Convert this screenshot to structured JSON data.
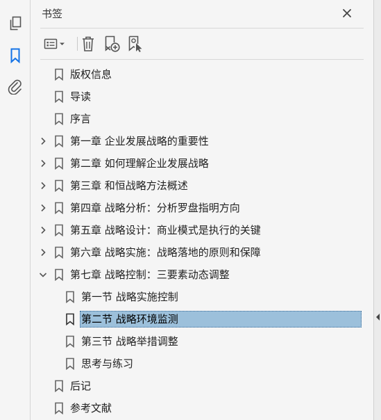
{
  "panel": {
    "title": "书签"
  },
  "tree": [
    {
      "label": "版权信息",
      "level": 1,
      "expandable": false
    },
    {
      "label": "导读",
      "level": 1,
      "expandable": false
    },
    {
      "label": "序言",
      "level": 1,
      "expandable": false
    },
    {
      "label": "第一章 企业发展战略的重要性",
      "level": 1,
      "expandable": true,
      "expanded": false
    },
    {
      "label": "第二章 如何理解企业发展战略",
      "level": 1,
      "expandable": true,
      "expanded": false
    },
    {
      "label": "第三章 和恒战略方法概述",
      "level": 1,
      "expandable": true,
      "expanded": false
    },
    {
      "label": "第四章 战略分析：分析罗盘指明方向",
      "level": 1,
      "expandable": true,
      "expanded": false
    },
    {
      "label": "第五章 战略设计：商业模式是执行的关键",
      "level": 1,
      "expandable": true,
      "expanded": false
    },
    {
      "label": "第六章 战略实施：战略落地的原则和保障",
      "level": 1,
      "expandable": true,
      "expanded": false
    },
    {
      "label": "第七章 战略控制：三要素动态调整",
      "level": 1,
      "expandable": true,
      "expanded": true
    },
    {
      "label": "第一节 战略实施控制",
      "level": 2,
      "expandable": false
    },
    {
      "label": "第二节 战略环境监测",
      "level": 2,
      "expandable": false,
      "selected": true
    },
    {
      "label": "第三节 战略举措调整",
      "level": 2,
      "expandable": false
    },
    {
      "label": "思考与练习",
      "level": 2,
      "expandable": false
    },
    {
      "label": "后记",
      "level": 1,
      "expandable": false
    },
    {
      "label": "参考文献",
      "level": 1,
      "expandable": false
    }
  ],
  "icons": {
    "rail": [
      "pages-icon",
      "bookmarks-icon",
      "attachments-icon"
    ],
    "toolbar": [
      "options-menu-icon",
      "delete-bookmark-icon",
      "new-bookmark-icon",
      "bookmark-from-selection-icon"
    ]
  },
  "colors": {
    "accent": "#1473e6",
    "selection": "#9cc0db"
  }
}
